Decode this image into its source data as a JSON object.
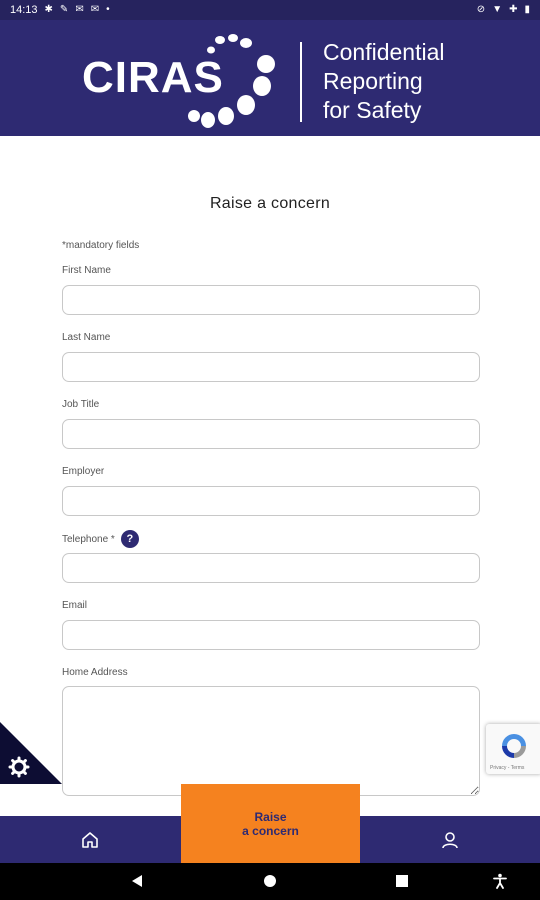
{
  "status_bar": {
    "time": "14:13"
  },
  "header": {
    "logo_text": "CIRAS",
    "tagline_line1": "Confidential",
    "tagline_line2": "Reporting",
    "tagline_line3": "for Safety"
  },
  "form": {
    "title": "Raise a concern",
    "mandatory_note": "*mandatory fields",
    "fields": [
      {
        "label": "First Name",
        "value": ""
      },
      {
        "label": "Last Name",
        "value": ""
      },
      {
        "label": "Job Title",
        "value": ""
      },
      {
        "label": "Employer",
        "value": ""
      },
      {
        "label": "Telephone *",
        "value": ""
      },
      {
        "label": "Email",
        "value": ""
      },
      {
        "label": "Home Address",
        "value": ""
      }
    ],
    "help_icon_glyph": "?"
  },
  "recaptcha": {
    "terms": "Privacy - Terms"
  },
  "bottom_nav": {
    "raise_line1": "Raise",
    "raise_line2": "a concern"
  },
  "colors": {
    "brand_navy": "#2e2a72",
    "accent_orange": "#f5821f"
  },
  "icons": {
    "home": "home-icon",
    "profile": "user-icon",
    "settings": "gear-icon",
    "help": "question-icon",
    "back": "back-triangle-icon",
    "home_system": "circle-home-icon",
    "recents": "square-recents-icon",
    "accessibility": "accessibility-icon"
  }
}
